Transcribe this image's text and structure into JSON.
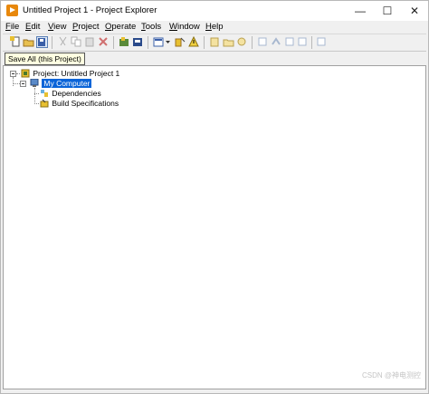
{
  "window": {
    "title": "Untitled Project 1 - Project Explorer"
  },
  "menu": [
    {
      "label": "File"
    },
    {
      "label": "Edit"
    },
    {
      "label": "View"
    },
    {
      "label": "Project"
    },
    {
      "label": "Operate"
    },
    {
      "label": "Tools"
    },
    {
      "label": "Window"
    },
    {
      "label": "Help"
    }
  ],
  "tooltip": "Save All (this Project)",
  "tree": {
    "root": "Project: Untitled Project 1",
    "computer": "My Computer",
    "children": [
      "Dependencies",
      "Build Specifications"
    ]
  },
  "watermark": "CSDN @神电测控"
}
